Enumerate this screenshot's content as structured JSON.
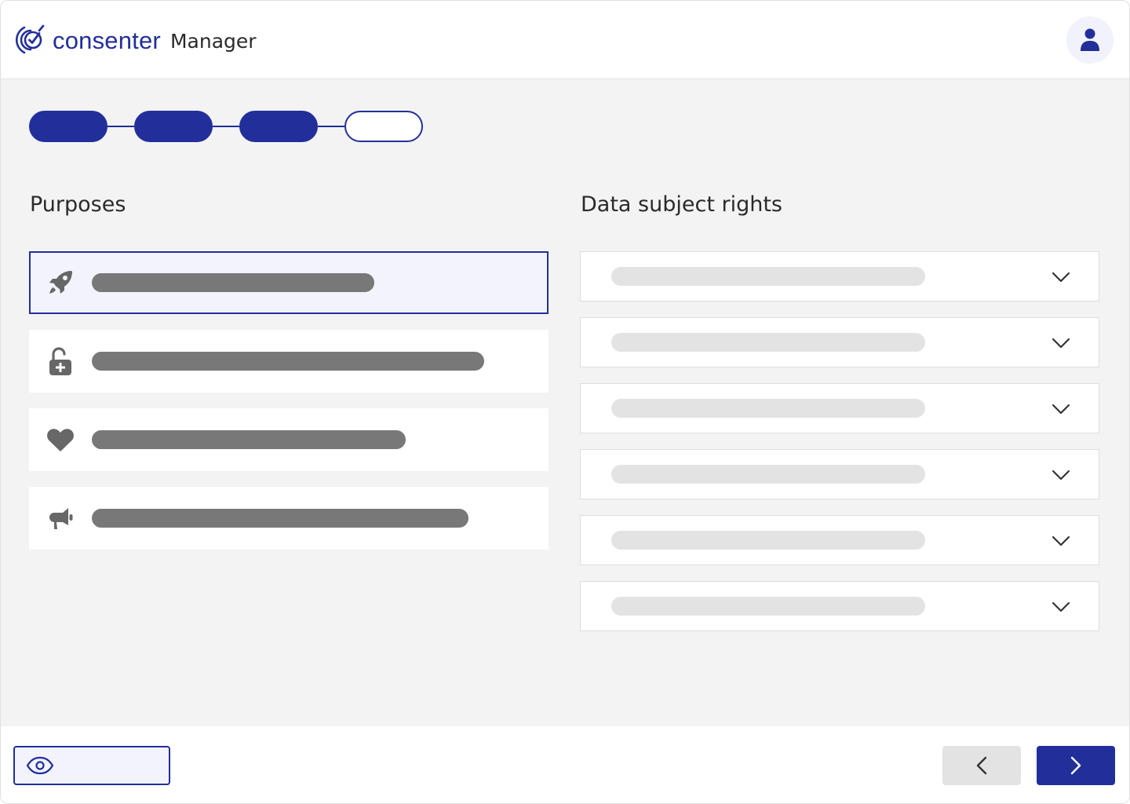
{
  "app": {
    "brand_name": "consenter",
    "product_name": "Manager",
    "accent_color": "#222f9a"
  },
  "header": {
    "user_icon": "user-icon"
  },
  "stepper": {
    "steps": [
      {
        "state": "completed"
      },
      {
        "state": "completed"
      },
      {
        "state": "completed"
      },
      {
        "state": "pending"
      }
    ]
  },
  "purposes": {
    "title": "Purposes",
    "items": [
      {
        "icon": "rocket-icon",
        "selected": true
      },
      {
        "icon": "unlock-plus-icon",
        "selected": false
      },
      {
        "icon": "heart-icon",
        "selected": false
      },
      {
        "icon": "megaphone-icon",
        "selected": false
      }
    ]
  },
  "rights": {
    "title": "Data subject rights",
    "items": [
      {
        "icon": "chevron-down-icon"
      },
      {
        "icon": "chevron-down-icon"
      },
      {
        "icon": "chevron-down-icon"
      },
      {
        "icon": "chevron-down-icon"
      },
      {
        "icon": "chevron-down-icon"
      },
      {
        "icon": "chevron-down-icon"
      }
    ]
  },
  "footer": {
    "preview_icon": "eye-icon",
    "back_icon": "chevron-left-icon",
    "next_icon": "chevron-right-icon"
  }
}
